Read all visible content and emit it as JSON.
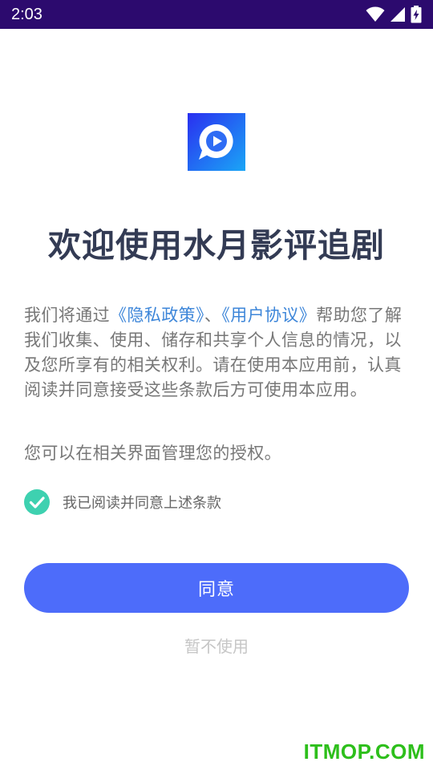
{
  "status_bar": {
    "time": "2:03",
    "icons": [
      "wifi-icon",
      "signal-icon",
      "battery-charging-icon"
    ]
  },
  "app": {
    "icon": "play-bubble-logo",
    "welcome_title": "欢迎使用水月影评追剧"
  },
  "policy": {
    "intro": "我们将通过",
    "privacy_link": "《隐私政策》",
    "separator": "、",
    "agreement_link": "《用户协议》",
    "body": "帮助您了解我们收集、使用、储存和共享个人信息的情况，以及您所享有的相关权利。请在使用本应用前，认真阅读并同意接受这些条款后方可使用本应用。",
    "auth_note": "您可以在相关界面管理您的授权。"
  },
  "agreement": {
    "checked": true,
    "label": "我已阅读并同意上述条款"
  },
  "buttons": {
    "agree": "同意",
    "decline": "暂不使用"
  },
  "watermark": "ITMOP.COM",
  "colors": {
    "status_bar": "#2c0a6e",
    "title": "#333b54",
    "link": "#3d86d9",
    "primary_button": "#4d6cfa",
    "checkbox": "#3ed1b0",
    "watermark": "#2dbf1b"
  }
}
